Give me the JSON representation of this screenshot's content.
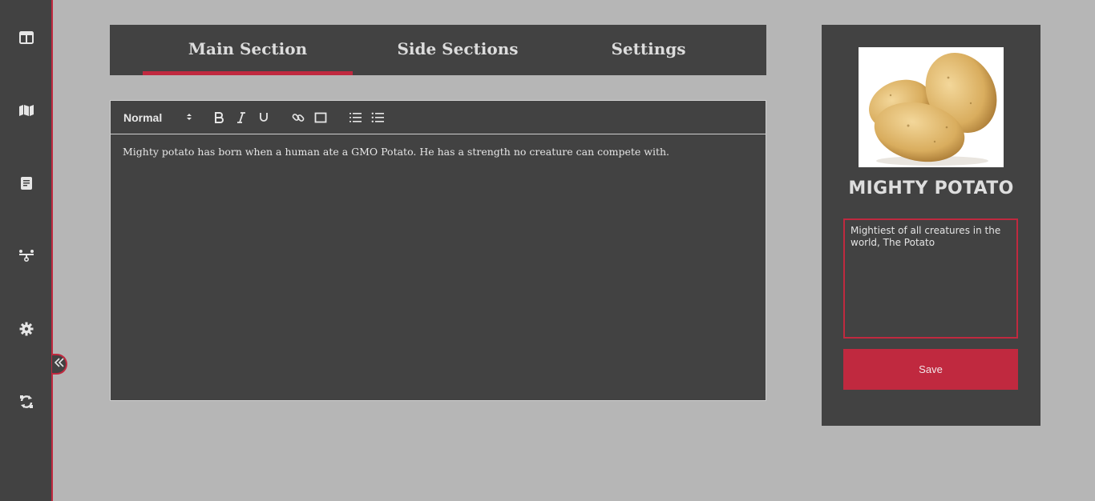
{
  "sidebar": {
    "items": [
      {
        "icon": "dashboard-icon"
      },
      {
        "icon": "map-icon"
      },
      {
        "icon": "book-icon"
      },
      {
        "icon": "hierarchy-icon"
      },
      {
        "icon": "gear-icon"
      },
      {
        "icon": "sync-icon"
      }
    ],
    "collapse_icon": "double-chevron-left-icon"
  },
  "tabs": [
    {
      "label": "Main Section",
      "active": true
    },
    {
      "label": "Side Sections",
      "active": false
    },
    {
      "label": "Settings",
      "active": false
    }
  ],
  "editor": {
    "format": "Normal",
    "toolbar_icons": [
      "bold-icon",
      "italic-icon",
      "underline-icon",
      "link-icon",
      "image-icon",
      "ordered-list-icon",
      "bullet-list-icon"
    ],
    "content": "Mighty potato has born when a human ate a GMO Potato. He has a strength no creature can compete with."
  },
  "card": {
    "title": "MIGHTY POTATO",
    "description": "Mightiest of all creatures in the world, The Potato",
    "save_label": "Save"
  },
  "colors": {
    "accent": "#c0293f",
    "panel": "#424242",
    "background": "#b6b6b6"
  }
}
